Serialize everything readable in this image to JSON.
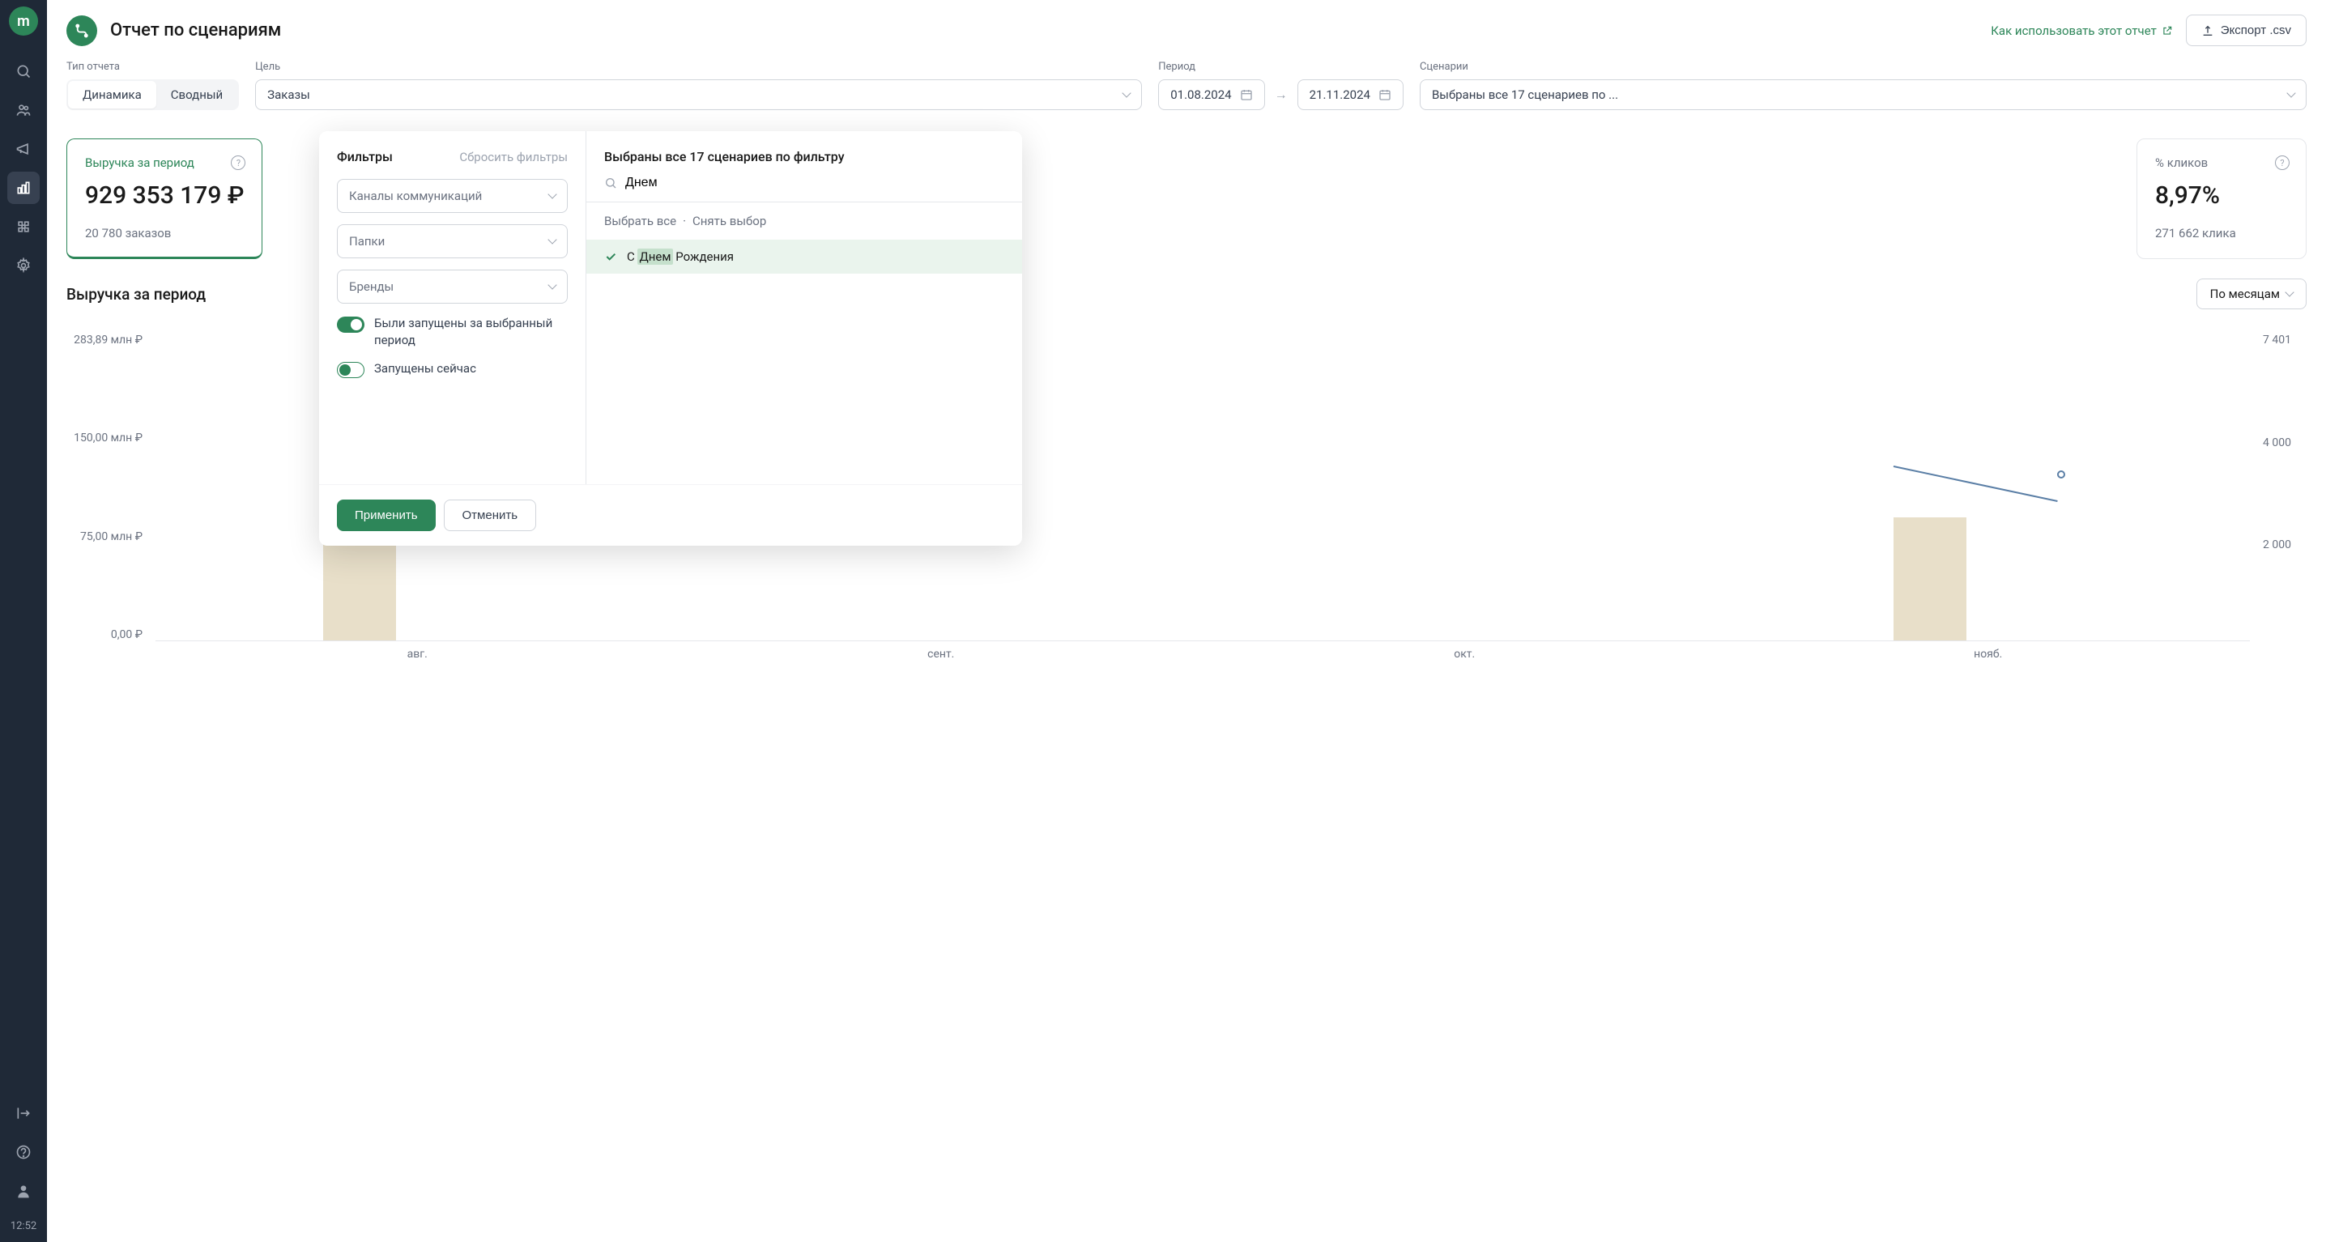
{
  "sidebar": {
    "logo": "m",
    "time": "12:52"
  },
  "header": {
    "title": "Отчет по сценариям",
    "help_link": "Как использовать этот отчет",
    "export_label": "Экспорт .csv"
  },
  "filters": {
    "report_type_label": "Тип отчета",
    "tab_dynamics": "Динамика",
    "tab_summary": "Сводный",
    "goal_label": "Цель",
    "goal_value": "Заказы",
    "period_label": "Период",
    "date_from": "01.08.2024",
    "date_to": "21.11.2024",
    "scenarios_label": "Сценарии",
    "scenarios_value": "Выбраны все 17 сценариев по ..."
  },
  "cards": {
    "revenue_title": "Выручка за период",
    "revenue_value": "929 353 179 ₽",
    "revenue_sub": "20 780 заказов",
    "clicks_title": "% кликов",
    "clicks_value": "8,97%",
    "clicks_sub": "271 662 клика"
  },
  "chart": {
    "title": "Выручка за период",
    "granularity": "По месяцам"
  },
  "chart_data": {
    "type": "bar",
    "categories": [
      "авг.",
      "сент.",
      "окт.",
      "нояб."
    ],
    "bars": [
      283.89,
      0,
      0,
      130
    ],
    "line": [
      null,
      null,
      null,
      4000
    ],
    "y_left_label": "млн ₽",
    "y_left_ticks": [
      "283,89 млн ₽",
      "150,00 млн ₽",
      "75,00 млн ₽",
      "0,00 ₽"
    ],
    "y_right_ticks": [
      "7 401",
      "4 000",
      "2 000",
      ""
    ],
    "y_left_range": [
      0,
      283.89
    ],
    "y_right_range": [
      0,
      7401
    ]
  },
  "dropdown": {
    "filters_title": "Фильтры",
    "reset_label": "Сбросить фильтры",
    "channels_placeholder": "Каналы коммуникаций",
    "folders_placeholder": "Папки",
    "brands_placeholder": "Бренды",
    "toggle1_label": "Были запущены за выбранный период",
    "toggle2_label": "Запущены сейчас",
    "right_title": "Выбраны все 17 сценариев по фильтру",
    "search_value": "Днем",
    "select_all": "Выбрать все",
    "deselect_all": "Снять выбор",
    "result_prefix": "С ",
    "result_highlight": "Днем",
    "result_suffix": " Рождения",
    "apply_label": "Применить",
    "cancel_label": "Отменить"
  }
}
